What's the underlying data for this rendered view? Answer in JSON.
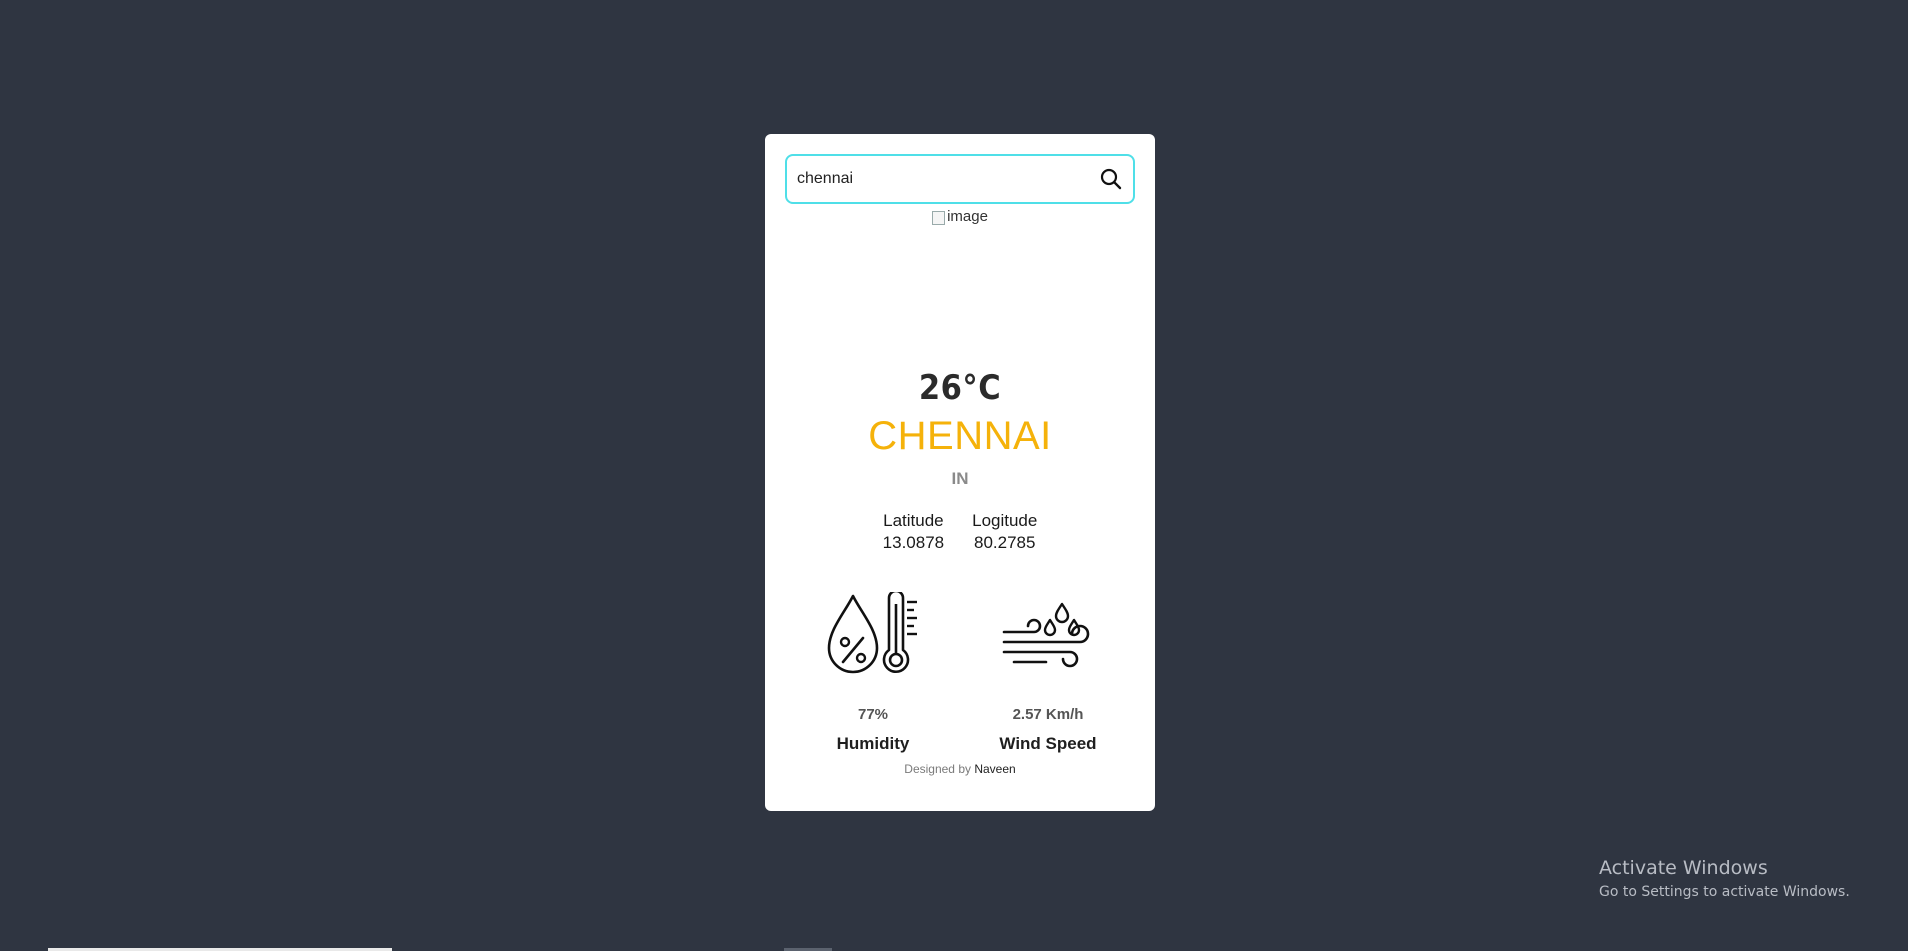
{
  "search": {
    "value": "chennai",
    "placeholder": "",
    "icon": "search-icon"
  },
  "weather": {
    "image_alt": "image",
    "temperature": "26°C",
    "city": "CHENNAI",
    "country": "IN",
    "latitude_label": "Latitude",
    "latitude_value": "13.0878",
    "longitude_label": "Logitude",
    "longitude_value": "80.2785"
  },
  "stats": {
    "humidity": {
      "icon": "humidity-icon",
      "value": "77%",
      "label": "Humidity"
    },
    "wind": {
      "icon": "wind-icon",
      "value": "2.57 Km/h",
      "label": "Wind Speed"
    }
  },
  "footer": {
    "prefix": "Designed by",
    "author": "Naveen"
  },
  "system": {
    "activate_title": "Activate Windows",
    "activate_sub": "Go to Settings to activate Windows."
  },
  "colors": {
    "background": "#2f3541",
    "card": "#ffffff",
    "search_border": "#4fdfe8",
    "city": "#f5b20a"
  }
}
